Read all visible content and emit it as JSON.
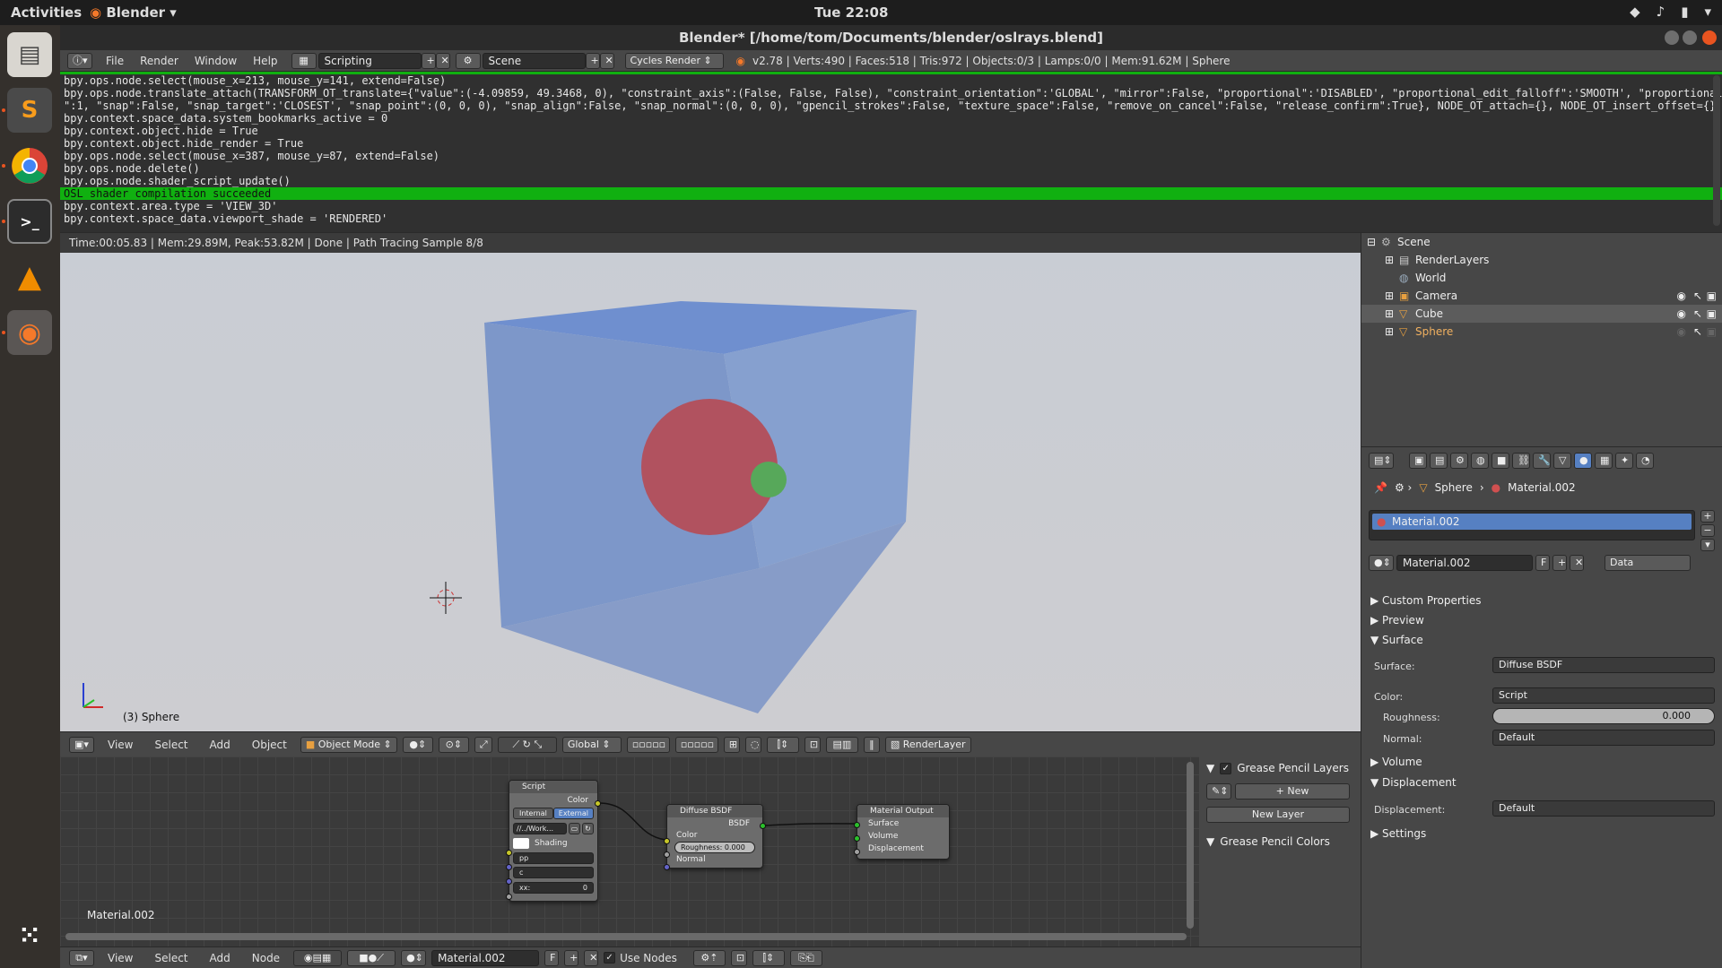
{
  "os": {
    "activities": "Activities",
    "app_menu": "Blender",
    "clock": "Tue 22:08",
    "launcher_items": [
      "files-icon",
      "sublime-icon",
      "chrome-icon",
      "terminal-icon",
      "vlc-icon",
      "blender-icon",
      "apps-grid-icon"
    ]
  },
  "window": {
    "title": "Blender* [/home/tom/Documents/blender/oslrays.blend]"
  },
  "info_header": {
    "menus": [
      "File",
      "Render",
      "Window",
      "Help"
    ],
    "layout": "Scripting",
    "scene": "Scene",
    "engine": "Cycles Render",
    "stats": "v2.78 | Verts:490 | Faces:518 | Tris:972 | Objects:0/3 | Lamps:0/0 | Mem:91.62M | Sphere"
  },
  "console": {
    "lines": [
      "bpy.ops.node.select(mouse_x=213, mouse_y=141, extend=False)",
      "bpy.ops.node.translate_attach(TRANSFORM_OT_translate={\"value\":(-4.09859, 49.3468, 0), \"constraint_axis\":(False, False, False), \"constraint_orientation\":'GLOBAL', \"mirror\":False, \"proportional\":'DISABLED', \"proportional_edit_falloff\":'SMOOTH', \"proportional_size",
      "\":1, \"snap\":False, \"snap_target\":'CLOSEST', \"snap_point\":(0, 0, 0), \"snap_align\":False, \"snap_normal\":(0, 0, 0), \"gpencil_strokes\":False, \"texture_space\":False, \"remove_on_cancel\":False, \"release_confirm\":True}, NODE_OT_attach={}, NODE_OT_insert_offset={})",
      "bpy.context.space_data.system_bookmarks_active = 0",
      "bpy.context.object.hide = True",
      "bpy.context.object.hide_render = True",
      "bpy.ops.node.select(mouse_x=387, mouse_y=87, extend=False)",
      "bpy.ops.node.delete()",
      "bpy.ops.node.shader_script_update()"
    ],
    "success_line": "OSL shader compilation succeeded",
    "after_lines": [
      "bpy.context.area.type = 'VIEW_3D'",
      "bpy.context.space_data.viewport_shade = 'RENDERED'"
    ]
  },
  "viewport": {
    "render_status": "Time:00:05.83 | Mem:29.89M, Peak:53.82M | Done | Path Tracing Sample 8/8",
    "active_object_label": "(3) Sphere",
    "colors": {
      "cube": "#7d97c9",
      "sphere": "#b1525f",
      "small_sphere": "#57a85a"
    }
  },
  "view3d_header": {
    "menus": [
      "View",
      "Select",
      "Add",
      "Object"
    ],
    "mode": "Object Mode",
    "orientation": "Global",
    "render_layer": "RenderLayer"
  },
  "node_editor": {
    "material_label": "Material.002",
    "script_node": {
      "title": "Script",
      "output": "Color",
      "internal": "Internal",
      "external": "External",
      "path": "//../Work...",
      "shading": "Shading",
      "inputs": [
        "pp",
        "c"
      ],
      "xx_label": "xx:",
      "xx_value": "0"
    },
    "diffuse_node": {
      "title": "Diffuse BSDF",
      "output": "BSDF",
      "color": "Color",
      "roughness": "Roughness: 0.000",
      "normal": "Normal"
    },
    "output_node": {
      "title": "Material Output",
      "surface": "Surface",
      "volume": "Volume",
      "displacement": "Displacement"
    }
  },
  "grease_pencil": {
    "layers_title": "Grease Pencil Layers",
    "new_label": "New",
    "new_layer_label": "New Layer",
    "colors_title": "Grease Pencil Colors"
  },
  "node_header": {
    "menus": [
      "View",
      "Select",
      "Add",
      "Node"
    ],
    "material": "Material.002",
    "fake_user": "F",
    "use_nodes": "Use Nodes"
  },
  "outliner": {
    "items": [
      {
        "label": "Scene",
        "icon": "scene-icon"
      },
      {
        "label": "RenderLayers",
        "icon": "renderlayers-icon"
      },
      {
        "label": "World",
        "icon": "world-icon"
      },
      {
        "label": "Camera",
        "icon": "camera-icon"
      },
      {
        "label": "Cube",
        "icon": "mesh-icon"
      },
      {
        "label": "Sphere",
        "icon": "mesh-icon"
      }
    ]
  },
  "properties": {
    "breadcrumb_object": "Sphere",
    "breadcrumb_material": "Material.002",
    "slot_material": "Material.002",
    "material_name": "Material.002",
    "fake_user": "F",
    "link": "Data",
    "sections": {
      "custom_props": "Custom Properties",
      "preview": "Preview",
      "surface": "Surface",
      "volume": "Volume",
      "displacement": "Displacement",
      "settings": "Settings"
    },
    "surface_label": "Surface:",
    "surface_value": "Diffuse BSDF",
    "color_label": "Color:",
    "color_value": "Script",
    "roughness_label": "Roughness:",
    "roughness_value": "0.000",
    "normal_label": "Normal:",
    "normal_value": "Default",
    "displacement_label": "Displacement:",
    "displacement_value": "Default"
  }
}
